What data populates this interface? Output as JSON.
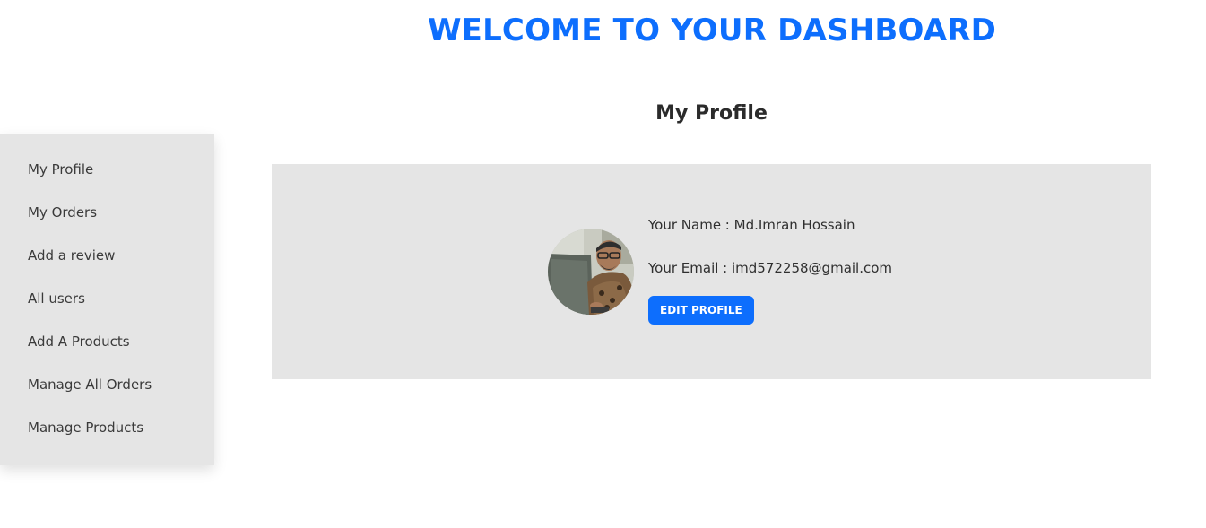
{
  "header": {
    "title": "WELCOME TO YOUR DASHBOARD"
  },
  "sidebar": {
    "items": [
      {
        "label": "My Profile"
      },
      {
        "label": "My Orders"
      },
      {
        "label": "Add a review"
      },
      {
        "label": "All users"
      },
      {
        "label": "Add A Products"
      },
      {
        "label": "Manage All Orders"
      },
      {
        "label": "Manage Products"
      }
    ]
  },
  "profile": {
    "section_title": "My Profile",
    "name_line": "Your Name : Md.Imran Hossain",
    "email_line": "Your Email : imd572258@gmail.com",
    "edit_button_label": "EDIT PROFILE",
    "avatar_icon": "user-photo"
  },
  "colors": {
    "accent": "#0d6efd",
    "panel_bg": "#e5e5e5"
  }
}
